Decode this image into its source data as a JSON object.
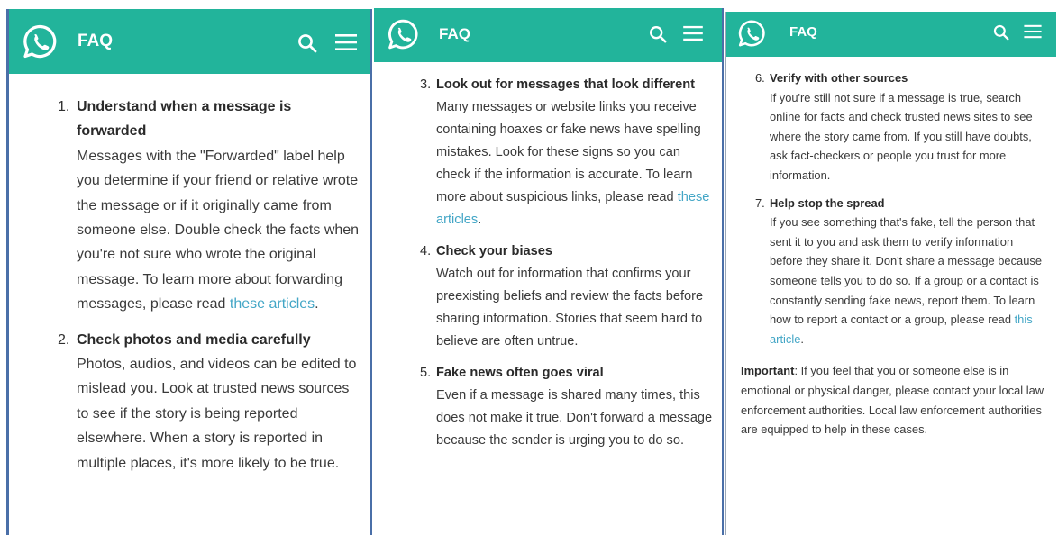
{
  "app": {
    "title": "FAQ",
    "brand_color": "#22b49b",
    "link_color": "#43a6c6",
    "icons": [
      "whatsapp-logo",
      "search-icon",
      "menu-icon"
    ]
  },
  "panel1": {
    "items": [
      {
        "num": "1.",
        "title": "Understand when a message is forwarded",
        "text": "Messages with the \"Forwarded\" label help you determine if your friend or relative wrote the message or if it originally came from someone else. Double check the facts when you're not sure who wrote the original message. To learn more about forwarding messages, please read ",
        "link": "these articles",
        "after": "."
      },
      {
        "num": "2.",
        "title": "Check photos and media carefully",
        "text": "Photos, audios, and videos can be edited to mislead you. Look at trusted news sources to see if the story is being reported elsewhere. When a story is reported in multiple places, it's more likely to be true."
      }
    ]
  },
  "panel2": {
    "items": [
      {
        "num": "3.",
        "title": "Look out for messages that look different",
        "text": "Many messages or website links you receive containing hoaxes or fake news have spelling mistakes. Look for these signs so you can check if the information is accurate. To learn more about suspicious links, please read ",
        "link": "these articles",
        "after": "."
      },
      {
        "num": "4.",
        "title": "Check your biases",
        "text": "Watch out for information that confirms your preexisting beliefs and review the facts before sharing information. Stories that seem hard to believe are often untrue."
      },
      {
        "num": "5.",
        "title": "Fake news often goes viral",
        "text": "Even if a message is shared many times, this does not make it true. Don't forward a message because the sender is urging you to do so."
      }
    ]
  },
  "panel3": {
    "items": [
      {
        "num": "6.",
        "title": "Verify with other sources",
        "text": "If you're still not sure if a message is true, search online for facts and check trusted news sites to see where the story came from. If you still have doubts, ask fact-checkers or people you trust for more information."
      },
      {
        "num": "7.",
        "title": "Help stop the spread",
        "text": "If you see something that's fake, tell the person that sent it to you and ask them to verify information before they share it. Don't share a message because someone tells you to do so. If a group or a contact is constantly sending fake news, report them. To learn how to report a contact or a group, please read ",
        "link": "this article",
        "after": "."
      }
    ],
    "important_label": "Important",
    "important_text": ": If you feel that you or someone else is in emotional or physical danger, please contact your local law enforcement authorities. Local law enforcement authorities are equipped to help in these cases."
  }
}
